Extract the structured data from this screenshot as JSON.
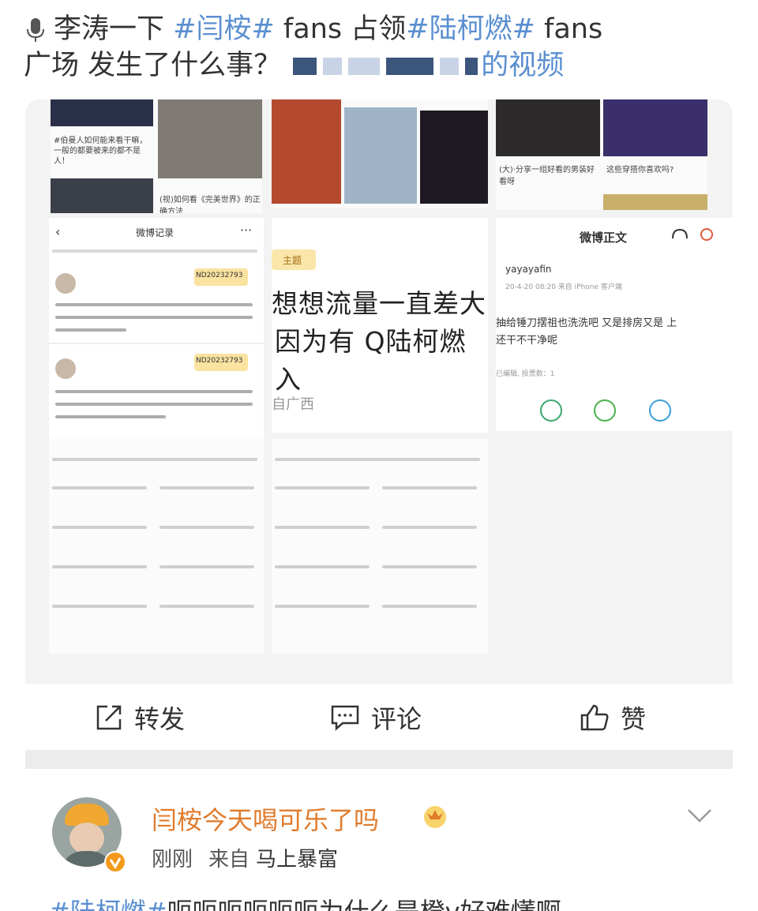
{
  "caption": {
    "line1_prefix": "李涛一下 ",
    "tag1": "#闫桉#",
    "line1_mid": " fans 占领",
    "tag2": "#陆柯燃#",
    "line1_suffix": " fans",
    "line2": "广场 发生了什么事？",
    "video_label": "的视频"
  },
  "screenshot": {
    "left_nav_title": "微博记录",
    "left_note_id_1": "ND20232793",
    "left_note_id_2": "ND20232793",
    "tile_small_caption_1": "#伯曼人如何能来看干嘛，一般的都要被来的都不是人！",
    "tile_small_caption_2": "(视)如何看《完美世界》的正确方法",
    "tile_top_right_caption_1": "(大)·分享一组好看的男装好看呀",
    "tile_top_right_caption_2": "这些穿搭你喜欢吗?",
    "center_tag": "主题",
    "center_line1": "想想流量一直差大",
    "center_line2": "因为有 Q陆柯燃入",
    "center_location": "自广西",
    "right_nav_title": "微博正文",
    "right_username": "yayayafin",
    "right_date": "20-4-20 08:20 来自 iPhone 客户端",
    "right_quote": "抽给锤刀摆祖也洗洗吧 又是排房又是 上",
    "right_quote2": "还干不干净呢",
    "right_sub": "已编辑, 投票数：1"
  },
  "actions": {
    "repost": "转发",
    "comment": "评论",
    "like": "赞"
  },
  "post": {
    "username": "闫桉今天喝可乐了吗",
    "time": "刚刚",
    "source_prefix": "来自",
    "source": "马上暴富",
    "body_tag": "#陆柯燃#",
    "body_text": "呃呃呃呃呃呃为什么是橙v好难懂啊"
  },
  "colors": {
    "link_blue": "#5a8fd0",
    "username_orange": "#e07b2c",
    "badge_yellow": "#f5c542"
  }
}
